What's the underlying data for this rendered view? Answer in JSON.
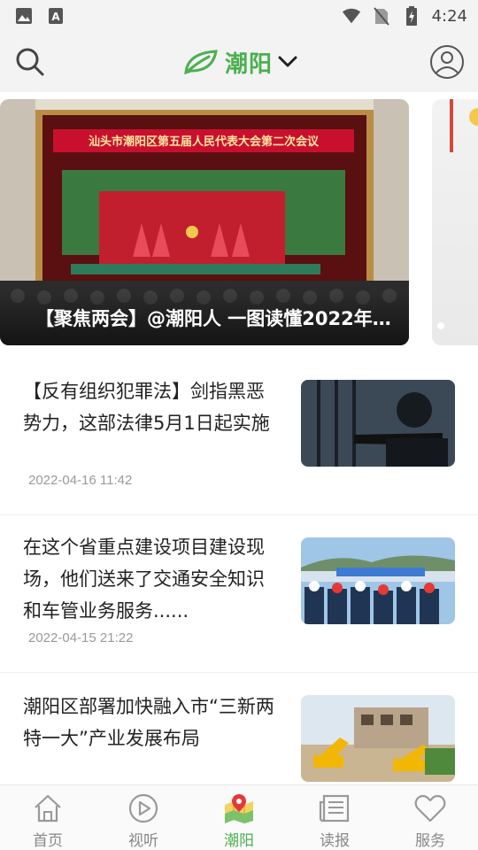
{
  "status_bar": {
    "time": "4:24",
    "left_icons": [
      "image-icon",
      "font-a-icon"
    ],
    "right_icons": [
      "wifi-icon",
      "no-sim-icon",
      "battery-charging-icon"
    ]
  },
  "header": {
    "channel_name": "潮阳",
    "accent_color": "#4caf50",
    "icons": [
      "search-icon",
      "leaf-logo-icon",
      "chevron-down-icon",
      "user-profile-icon"
    ]
  },
  "banner": {
    "slides": [
      {
        "caption": "【聚焦两会】@潮阳人 一图读懂2022年潮…",
        "banner_text": "汕头市潮阳区第五届人民代表大会第二次会议"
      }
    ],
    "active_index": 0
  },
  "news": [
    {
      "title": "【反有组织犯罪法】剑指黑恶势力，这部法律5月1日起实施",
      "date": "2022-04-16 11:42"
    },
    {
      "title": "在这个省重点建设项目建设现场，他们送来了交通安全知识和车管业务服务......",
      "date": "2022-04-15 21:22"
    },
    {
      "title": "潮阳区部署加快融入市“三新两特一大”产业发展布局",
      "date": ""
    }
  ],
  "bottom_nav": {
    "items": [
      {
        "label": "首页",
        "icon": "home-icon"
      },
      {
        "label": "视听",
        "icon": "play-circle-icon"
      },
      {
        "label": "潮阳",
        "icon": "map-pin-icon"
      },
      {
        "label": "读报",
        "icon": "newspaper-icon"
      },
      {
        "label": "服务",
        "icon": "heart-icon"
      }
    ],
    "active": "潮阳"
  }
}
